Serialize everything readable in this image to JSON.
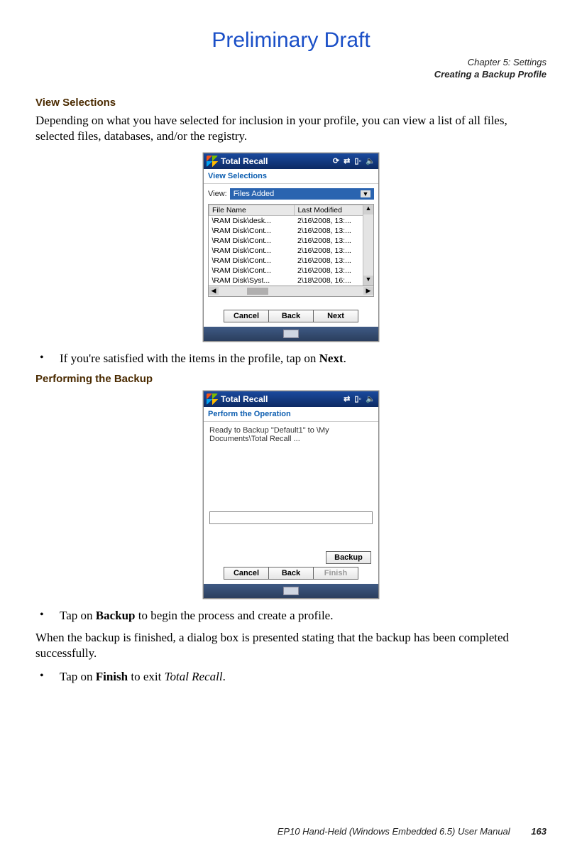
{
  "draft_label": "Preliminary Draft",
  "chapter_line1": "Chapter 5: Settings",
  "chapter_line2": "Creating a Backup Profile",
  "section1": {
    "heading": "View Selections",
    "para": "Depending on what you have selected for inclusion in your profile, you can view a list of all files, selected files, databases, and/or the registry."
  },
  "screenshot1": {
    "title": "Total Recall",
    "subtitle": "View Selections",
    "view_label": "View:",
    "dropdown_selected": "Files Added",
    "columns": [
      "File Name",
      "Last Modified"
    ],
    "rows": [
      {
        "name": "\\RAM Disk\\desk...",
        "mod": "2\\16\\2008, 13:..."
      },
      {
        "name": "\\RAM Disk\\Cont...",
        "mod": "2\\16\\2008, 13:..."
      },
      {
        "name": "\\RAM Disk\\Cont...",
        "mod": "2\\16\\2008, 13:..."
      },
      {
        "name": "\\RAM Disk\\Cont...",
        "mod": "2\\16\\2008, 13:..."
      },
      {
        "name": "\\RAM Disk\\Cont...",
        "mod": "2\\16\\2008, 13:..."
      },
      {
        "name": "\\RAM Disk\\Cont...",
        "mod": "2\\16\\2008, 13:..."
      },
      {
        "name": "\\RAM Disk\\Syst...",
        "mod": "2\\18\\2008, 16:..."
      }
    ],
    "buttons": {
      "cancel": "Cancel",
      "back": "Back",
      "next": "Next"
    }
  },
  "bullet1_pre": "If you're satisfied with the items in the profile, tap on ",
  "bullet1_bold": "Next",
  "bullet1_post": ".",
  "section2": {
    "heading": "Performing the Backup"
  },
  "screenshot2": {
    "title": "Total Recall",
    "subtitle": "Perform the Operation",
    "message": "Ready to Backup \"Default1\" to \\My Documents\\Total Recall ...",
    "backup_btn": "Backup",
    "buttons": {
      "cancel": "Cancel",
      "back": "Back",
      "finish": "Finish"
    }
  },
  "bullet2_pre": "Tap on ",
  "bullet2_bold": "Backup",
  "bullet2_post": " to begin the process and create a profile.",
  "para_after": "When the backup is finished, a dialog box is presented stating that the backup has been completed successfully.",
  "bullet3_pre": "Tap on ",
  "bullet3_bold": "Finish",
  "bullet3_mid": " to exit ",
  "bullet3_italic": "Total Recall",
  "bullet3_post": ".",
  "footer_text": "EP10 Hand-Held (Windows Embedded 6.5) User Manual",
  "page_number": "163"
}
